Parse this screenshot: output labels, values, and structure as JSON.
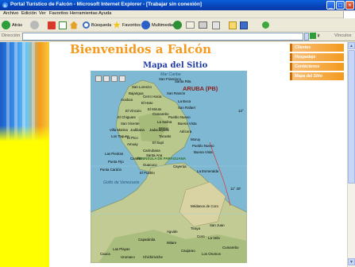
{
  "window": {
    "title": "Portal Turístico de Falcón - Microsoft Internet Explorer - [Trabajar sin conexión]",
    "buttons": [
      "_",
      "□",
      "×"
    ]
  },
  "menubar": {
    "items": [
      "Archivo",
      "Edición",
      "Ver",
      "Favoritos",
      "Herramientas",
      "Ayuda"
    ]
  },
  "toolbar": {
    "back_label": "Atrás",
    "search_label": "Búsqueda",
    "favorites_label": "Favoritos",
    "multimedia_label": "Multimedia"
  },
  "addressbar": {
    "label": "Dirección",
    "value": "",
    "go_label": "Ir",
    "links_label": "Vínculos"
  },
  "page": {
    "welcome": "Bienvenidos a Falcón",
    "map_title": "Mapa del Sitio",
    "nav": [
      "Clientes",
      "Hospedaje",
      "Contáctenos",
      "Mapa del Sitio"
    ]
  },
  "map": {
    "sea_labels": [
      "Mar Caribe",
      "Golfo de Venezuela"
    ],
    "region_label": "ARUBA (PB)",
    "peninsula_label": "PENINSULA DE PARAGUANA",
    "coordinates": [
      "12°",
      "11° 30'"
    ],
    "places": [
      "Santa Rita",
      "San Francisco",
      "San Lorenzo",
      "Bajarigua",
      "Acaboa",
      "Cerro Hacia",
      "El Hato",
      "El Miruto",
      "Cumarebo",
      "El Vínculo",
      "San Ramón",
      "La Boca",
      "San Rafael",
      "Pueblo Nuevo",
      "El Chiguare",
      "San Vicente",
      "La Salina",
      "Moruy",
      "Buena Vista",
      "Adícora",
      "Tacuato",
      "Las Piedras",
      "Punta Fijo",
      "Punta Cardón",
      "Cardón",
      "Guacuco",
      "Amuay",
      "Carirubana",
      "El Supí",
      "Jadacaquiva",
      "Los Taques",
      "Villa Marina",
      "Judibana",
      "El Pico",
      "Santa Ana",
      "El Pueblo",
      "Moruy",
      "Pueblo Nuevo",
      "Buena Vista",
      "Cayerúa",
      "Tiraya",
      "La Vela",
      "Coro",
      "San Juan",
      "Cumarebo",
      "Mitare",
      "Caujarao",
      "Los Orumos",
      "Aguide",
      "Capatárida",
      "Cauca",
      "Las Playas",
      "Urumaco",
      "Chichiriviche",
      "Tucacas",
      "El Paují",
      "Carrizal",
      "Guaibacoa",
      "Jacura",
      "Cabure",
      "Mirimire",
      "Los Pozos",
      "Sanare",
      "Pedregal",
      "Dabajuro",
      "Churuguara",
      "Mene de Mauroa",
      "Casigua",
      "Pecaya",
      "Esmeralda",
      "La Esmeralda",
      "Médanos de Coro"
    ]
  }
}
